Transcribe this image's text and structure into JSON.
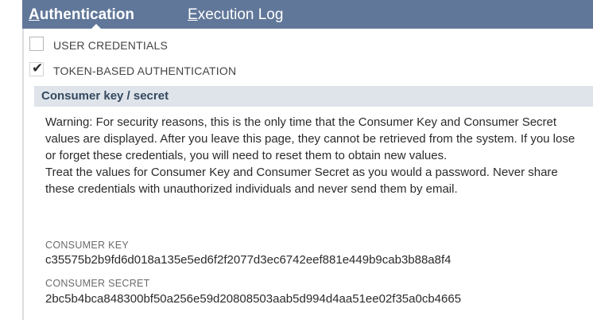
{
  "tabs": {
    "authentication": {
      "first": "A",
      "rest": "uthentication"
    },
    "execution_log": {
      "first": "E",
      "rest": "xecution Log"
    }
  },
  "options": {
    "user_credentials": {
      "label": "USER CREDENTIALS",
      "checked": false
    },
    "token_based": {
      "label": "TOKEN-BASED AUTHENTICATION",
      "checked": true
    }
  },
  "consumer_section": {
    "title": "Consumer key / secret",
    "warning_1": "Warning: For security reasons, this is the only time that the Consumer Key and Consumer Secret values are displayed. After you leave this page, they cannot be retrieved from the system. If you lose or forget these credentials, you will need to reset them to obtain new values.",
    "warning_2": "Treat the values for Consumer Key and Consumer Secret as you would a password. Never share these credentials with unauthorized individuals and never send them by email.",
    "consumer_key_label": "CONSUMER KEY",
    "consumer_key_value": "c35575b2b9fd6d018a135e5ed6f2f2077d3ec6742eef881e449b9cab3b88a8f4",
    "consumer_secret_label": "CONSUMER SECRET",
    "consumer_secret_value": "2bc5b4bca848300bf50a256e59d20808503aab5d994d4aa51ee02f35a0cb4665"
  },
  "icons": {
    "checkmark": "checkmark-icon",
    "active_tab_pointer": "caret-up-icon"
  }
}
